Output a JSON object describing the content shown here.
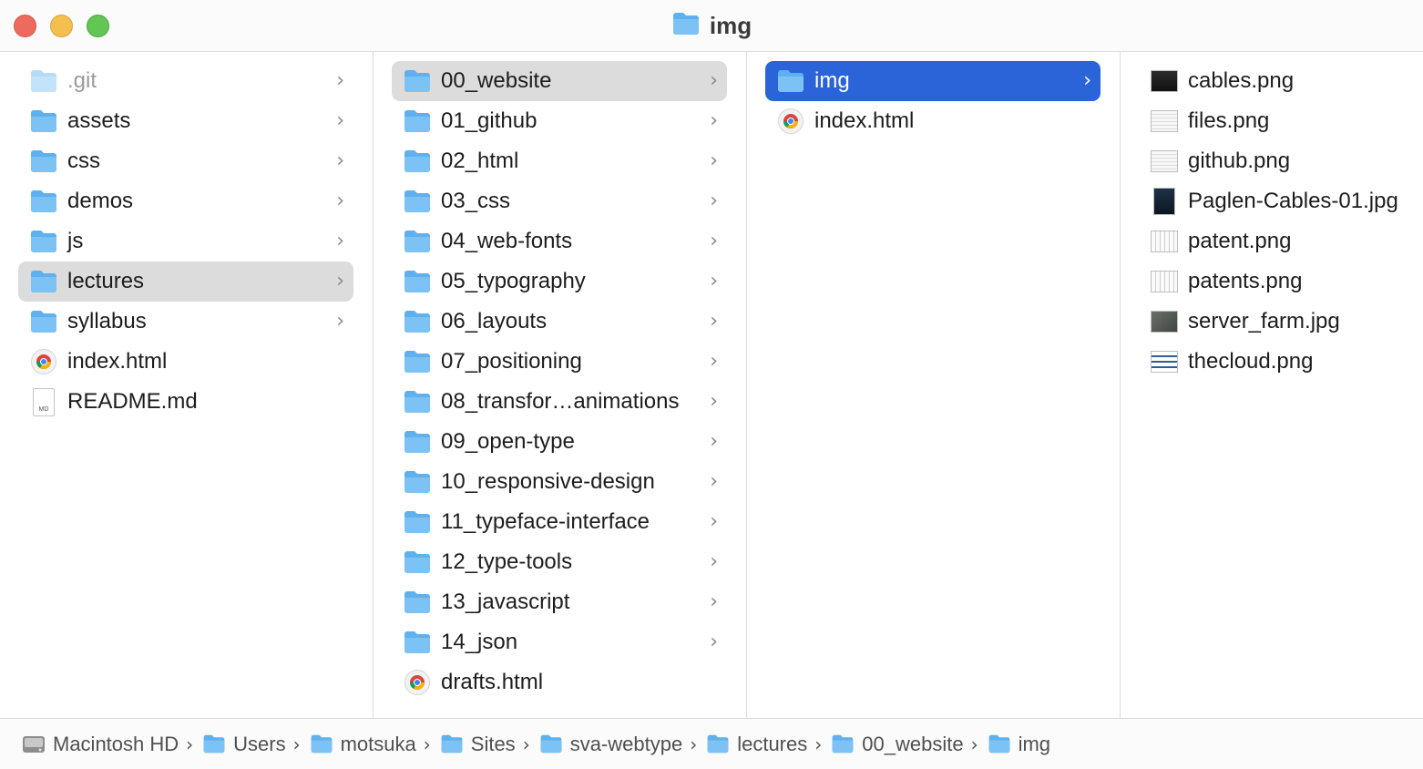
{
  "window": {
    "title": "img"
  },
  "columns": [
    {
      "items": [
        {
          "label": ".git",
          "icon": "folder-icon",
          "chevron": true,
          "state": "dim"
        },
        {
          "label": "assets",
          "icon": "folder-icon",
          "chevron": true
        },
        {
          "label": "css",
          "icon": "folder-icon",
          "chevron": true
        },
        {
          "label": "demos",
          "icon": "folder-icon",
          "chevron": true
        },
        {
          "label": "js",
          "icon": "folder-icon",
          "chevron": true
        },
        {
          "label": "lectures",
          "icon": "folder-icon",
          "chevron": true,
          "state": "sel-gray"
        },
        {
          "label": "syllabus",
          "icon": "folder-icon",
          "chevron": true
        },
        {
          "label": "index.html",
          "icon": "chrome-file-icon",
          "chevron": false
        },
        {
          "label": "README.md",
          "icon": "markdown-file-icon",
          "chevron": false,
          "badge": "MD"
        }
      ]
    },
    {
      "items": [
        {
          "label": "00_website",
          "icon": "folder-icon",
          "chevron": true,
          "state": "sel-gray"
        },
        {
          "label": "01_github",
          "icon": "folder-icon",
          "chevron": true
        },
        {
          "label": "02_html",
          "icon": "folder-icon",
          "chevron": true
        },
        {
          "label": "03_css",
          "icon": "folder-icon",
          "chevron": true
        },
        {
          "label": "04_web-fonts",
          "icon": "folder-icon",
          "chevron": true
        },
        {
          "label": "05_typography",
          "icon": "folder-icon",
          "chevron": true
        },
        {
          "label": "06_layouts",
          "icon": "folder-icon",
          "chevron": true
        },
        {
          "label": "07_positioning",
          "icon": "folder-icon",
          "chevron": true
        },
        {
          "label": "08_transfor…animations",
          "icon": "folder-icon",
          "chevron": true
        },
        {
          "label": "09_open-type",
          "icon": "folder-icon",
          "chevron": true
        },
        {
          "label": "10_responsive-design",
          "icon": "folder-icon",
          "chevron": true
        },
        {
          "label": "11_typeface-interface",
          "icon": "folder-icon",
          "chevron": true
        },
        {
          "label": "12_type-tools",
          "icon": "folder-icon",
          "chevron": true
        },
        {
          "label": "13_javascript",
          "icon": "folder-icon",
          "chevron": true
        },
        {
          "label": "14_json",
          "icon": "folder-icon",
          "chevron": true
        },
        {
          "label": "drafts.html",
          "icon": "chrome-file-icon",
          "chevron": false
        }
      ]
    },
    {
      "items": [
        {
          "label": "img",
          "icon": "folder-icon",
          "chevron": true,
          "state": "sel-blue"
        },
        {
          "label": "index.html",
          "icon": "chrome-file-icon",
          "chevron": false
        }
      ]
    },
    {
      "items": [
        {
          "label": "cables.png",
          "icon": "image-thumbnail-icon",
          "thumb": "th-dark"
        },
        {
          "label": "files.png",
          "icon": "image-thumbnail-icon",
          "thumb": "th-light"
        },
        {
          "label": "github.png",
          "icon": "image-thumbnail-icon",
          "thumb": "th-light"
        },
        {
          "label": "Paglen-Cables-01.jpg",
          "icon": "image-thumbnail-icon",
          "thumb": "th-blue"
        },
        {
          "label": "patent.png",
          "icon": "image-thumbnail-icon",
          "thumb": "th-sketch"
        },
        {
          "label": "patents.png",
          "icon": "image-thumbnail-icon",
          "thumb": "th-sketch"
        },
        {
          "label": "server_farm.jpg",
          "icon": "image-thumbnail-icon",
          "thumb": "th-farm"
        },
        {
          "label": "thecloud.png",
          "icon": "image-thumbnail-icon",
          "thumb": "th-cloud"
        }
      ]
    }
  ],
  "pathbar": [
    {
      "label": "Macintosh HD",
      "icon": "hard-drive-icon"
    },
    {
      "label": "Users",
      "icon": "users-folder-icon"
    },
    {
      "label": "motsuka",
      "icon": "home-folder-icon"
    },
    {
      "label": "Sites",
      "icon": "sites-folder-icon"
    },
    {
      "label": "sva-webtype",
      "icon": "folder-icon"
    },
    {
      "label": "lectures",
      "icon": "folder-icon"
    },
    {
      "label": "00_website",
      "icon": "folder-icon"
    },
    {
      "label": "img",
      "icon": "folder-icon"
    }
  ],
  "colors": {
    "selection_blue": "#2b63d9",
    "selection_gray": "#dcdcdc",
    "folder_blue": "#5fb0ee"
  }
}
